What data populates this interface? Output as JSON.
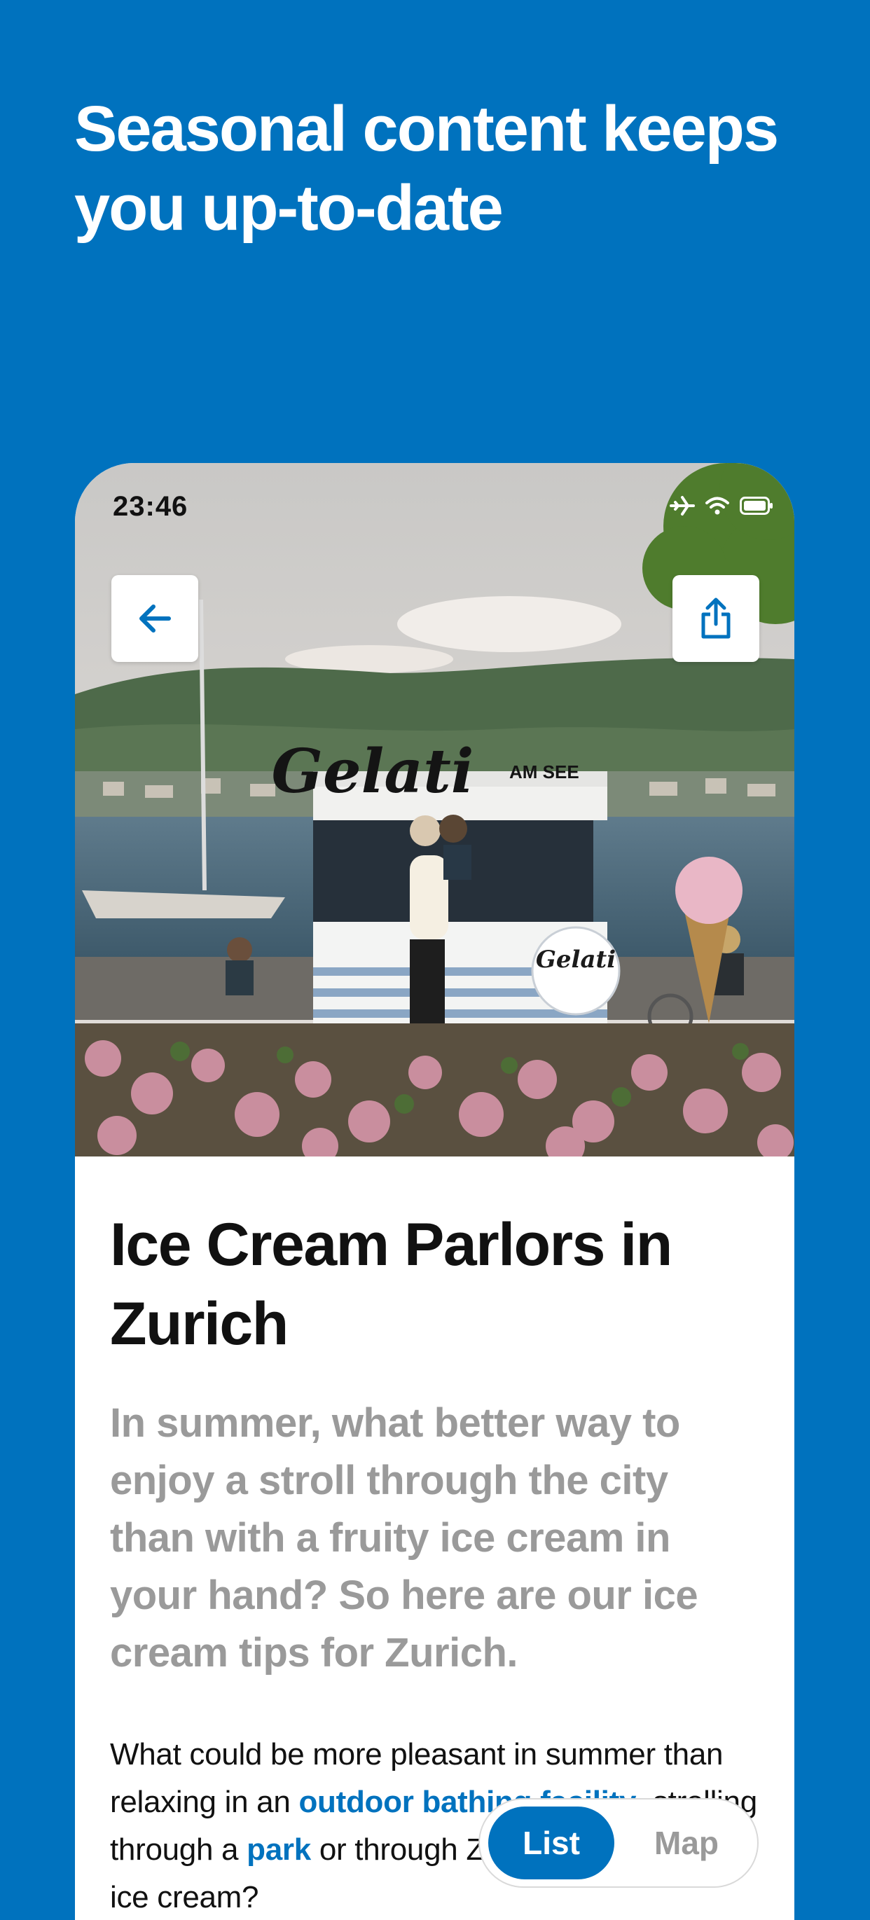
{
  "promo": {
    "headline": "Seasonal content keeps you up-to-date"
  },
  "status_bar": {
    "time": "23:46",
    "icons": [
      "airplane-mode-icon",
      "wifi-icon",
      "battery-icon"
    ]
  },
  "hero": {
    "sign_text": "Gelati",
    "sign_subtext": "AM SEE",
    "cart_logo": "Gelati"
  },
  "toolbar": {
    "back_icon": "arrow-left-icon",
    "share_icon": "share-icon"
  },
  "article": {
    "title": "Ice Cream Parlors in Zurich",
    "lead": "In summer, what better way to enjoy a stroll through the city than with a fruity ice cream in your hand? So here are our ice cream tips for Zurich.",
    "body_1": "What could be more pleasant in summer than relaxing in an ",
    "link_1": "outdoor bathing facility",
    "body_2": ", strolling through a ",
    "link_2": "park",
    "body_3": " or through Zurich licking a fruity ice cream?"
  },
  "view_toggle": {
    "list_label": "List",
    "map_label": "Map",
    "selected": "List"
  },
  "colors": {
    "brand_blue": "#0072BE",
    "text_dark": "#111111",
    "text_muted": "#9a9a9a"
  }
}
